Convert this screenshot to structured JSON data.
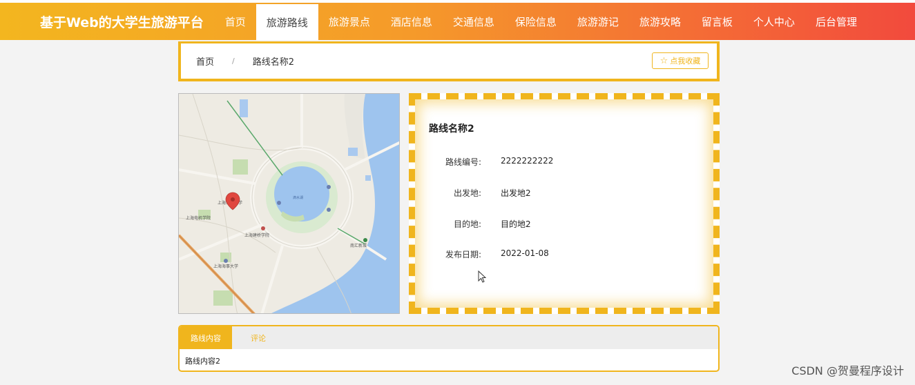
{
  "header": {
    "brand": "基于Web的大学生旅游平台",
    "nav": [
      {
        "label": "首页",
        "active": false
      },
      {
        "label": "旅游路线",
        "active": true
      },
      {
        "label": "旅游景点",
        "active": false
      },
      {
        "label": "酒店信息",
        "active": false
      },
      {
        "label": "交通信息",
        "active": false
      },
      {
        "label": "保险信息",
        "active": false
      },
      {
        "label": "旅游游记",
        "active": false
      },
      {
        "label": "旅游攻略",
        "active": false
      },
      {
        "label": "留言板",
        "active": false
      },
      {
        "label": "个人中心",
        "active": false
      },
      {
        "label": "后台管理",
        "active": false
      }
    ]
  },
  "breadcrumb": {
    "home": "首页",
    "separator": "/",
    "current": "路线名称2",
    "favorite_label": "点我收藏"
  },
  "map": {
    "labels": [
      "上海海洋大学",
      "滴水湖",
      "上海电机学院",
      "上海建桥学院",
      "南汇新城",
      "上海海事大学"
    ]
  },
  "detail": {
    "title": "路线名称2",
    "fields": [
      {
        "label": "路线编号:",
        "value": "2222222222"
      },
      {
        "label": "出发地:",
        "value": "出发地2"
      },
      {
        "label": "目的地:",
        "value": "目的地2"
      },
      {
        "label": "发布日期:",
        "value": "2022-01-08"
      }
    ]
  },
  "tabs": {
    "items": [
      {
        "label": "路线内容",
        "active": true
      },
      {
        "label": "评论",
        "active": false
      }
    ],
    "content": "路线内容2"
  },
  "watermark": "CSDN @贺曼程序设计",
  "colors": {
    "accent": "#f0b51d",
    "header_start": "#f3b61f",
    "header_end": "#f24a3d"
  }
}
